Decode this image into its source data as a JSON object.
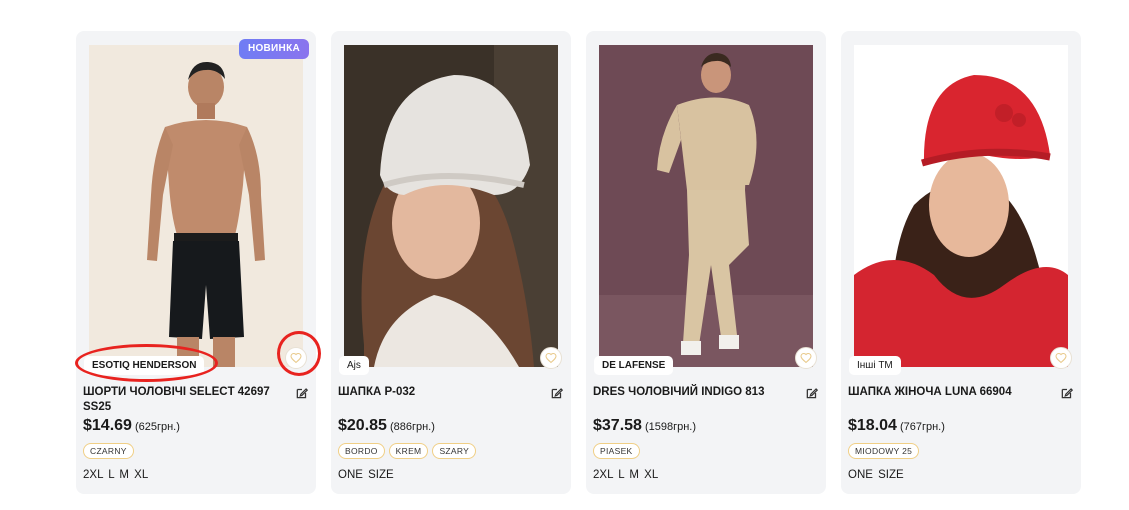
{
  "products": [
    {
      "badge": "НОВИНКА",
      "brand": "ESOTIQ HENDERSON",
      "title": "ШОРТИ ЧОЛОВІЧІ SELECT 42697 SS25",
      "price_usd": "$14.69",
      "price_uah": "(625грн.)",
      "colors": [
        "CZARNY"
      ],
      "sizes": "2XL L M XL"
    },
    {
      "brand": "Ajs",
      "title": "ШАПКА P-032",
      "price_usd": "$20.85",
      "price_uah": "(886грн.)",
      "colors": [
        "BORDO",
        "KREM",
        "SZARY"
      ],
      "sizes": "ONE SIZE"
    },
    {
      "brand": "DE LAFENSE",
      "title": "DRES ЧОЛОВІЧИЙ INDIGO 813",
      "price_usd": "$37.58",
      "price_uah": "(1598грн.)",
      "colors": [
        "PIASEK"
      ],
      "sizes": "2XL L M XL"
    },
    {
      "brand": "Інші ТМ",
      "title": "ШАПКА ЖІНОЧА LUNA 66904",
      "price_usd": "$18.04",
      "price_uah": "(767грн.)",
      "colors": [
        "MIODOWY 25"
      ],
      "sizes": "ONE SIZE"
    }
  ],
  "icons": {
    "favorite": "heart-icon",
    "edit": "edit-icon"
  },
  "colors": {
    "card_bg": "#f3f4f6",
    "badge_new": "#7b7af2",
    "chip_border": "#f0cf86",
    "annotation": "#e8231f"
  }
}
